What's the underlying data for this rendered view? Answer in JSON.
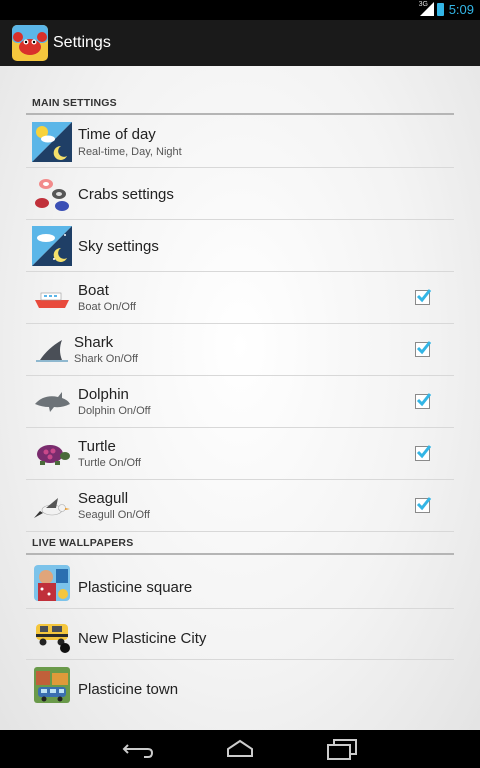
{
  "status_bar": {
    "network": "3G",
    "time": "5:09"
  },
  "action_bar": {
    "title": "Settings",
    "app_icon": "crab-app-icon"
  },
  "sections": {
    "main": "MAIN SETTINGS",
    "live": "LIVE WALLPAPERS"
  },
  "main_items": [
    {
      "title": "Time of day",
      "summary": "Real-time, Day, Night",
      "icon": "day-night-icon"
    },
    {
      "title": "Crabs settings",
      "icon": "crabs-icon"
    },
    {
      "title": "Sky settings",
      "icon": "sky-icon"
    },
    {
      "title": "Boat",
      "summary": "Boat On/Off",
      "checked": true,
      "icon": "boat-icon"
    },
    {
      "title": "Shark",
      "summary": "Shark On/Off",
      "checked": true,
      "icon": "shark-fin-icon"
    },
    {
      "title": "Dolphin",
      "summary": "Dolphin On/Off",
      "checked": true,
      "icon": "dolphin-icon"
    },
    {
      "title": "Turtle",
      "summary": "Turtle On/Off",
      "checked": true,
      "icon": "turtle-icon"
    },
    {
      "title": "Seagull",
      "summary": "Seagull On/Off",
      "checked": true,
      "icon": "seagull-icon"
    }
  ],
  "live_items": [
    {
      "title": "Plasticine square",
      "icon": "plasticine-square-icon"
    },
    {
      "title": "New Plasticine City",
      "icon": "plasticine-city-icon"
    },
    {
      "title": "Plasticine town",
      "icon": "plasticine-town-icon"
    }
  ],
  "colors": {
    "accent": "#33b5e5",
    "action_bar": "#1a1a1a",
    "checkbox": "#33b5e5"
  }
}
